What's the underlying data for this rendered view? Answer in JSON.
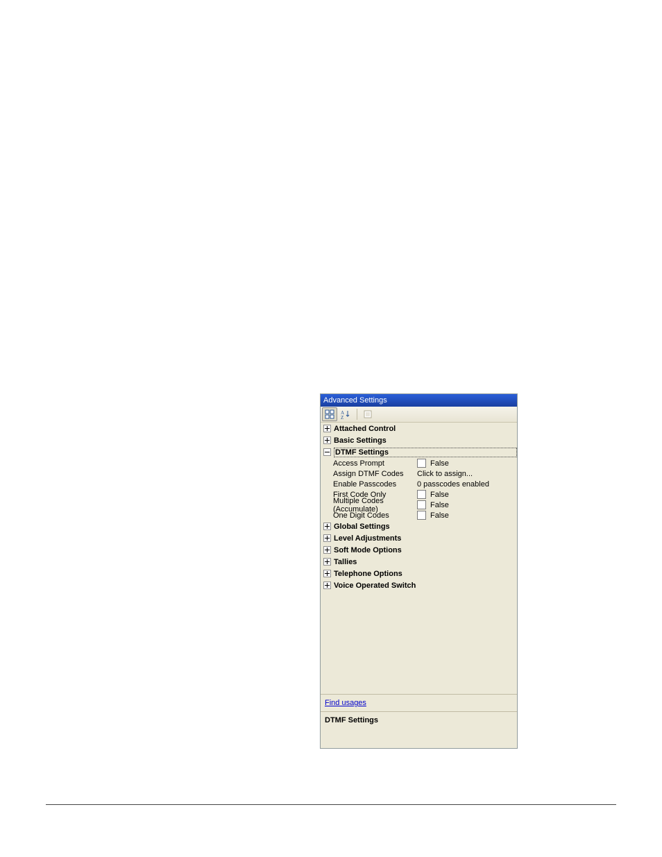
{
  "panel": {
    "title": "Advanced Settings",
    "link": "Find usages",
    "desc_title": "DTMF Settings",
    "categories": [
      {
        "label": "Attached Control",
        "state": "plus"
      },
      {
        "label": "Basic Settings",
        "state": "plus"
      },
      {
        "label": "DTMF Settings",
        "state": "minus",
        "selected": true,
        "rows": [
          {
            "name": "Access Prompt",
            "kind": "check",
            "value": "False"
          },
          {
            "name": "Assign DTMF Codes",
            "kind": "text",
            "value": "Click to assign..."
          },
          {
            "name": "Enable Passcodes",
            "kind": "text",
            "value": "0 passcodes enabled"
          },
          {
            "name": "First Code Only",
            "kind": "check",
            "value": "False"
          },
          {
            "name": "Multiple Codes (Accumulate)",
            "kind": "check",
            "value": "False"
          },
          {
            "name": "One Digit Codes",
            "kind": "check",
            "value": "False"
          }
        ]
      },
      {
        "label": "Global Settings",
        "state": "plus"
      },
      {
        "label": "Level Adjustments",
        "state": "plus"
      },
      {
        "label": "Soft Mode Options",
        "state": "plus"
      },
      {
        "label": "Tallies",
        "state": "plus"
      },
      {
        "label": "Telephone Options",
        "state": "plus"
      },
      {
        "label": "Voice Operated Switch",
        "state": "plus"
      }
    ]
  }
}
